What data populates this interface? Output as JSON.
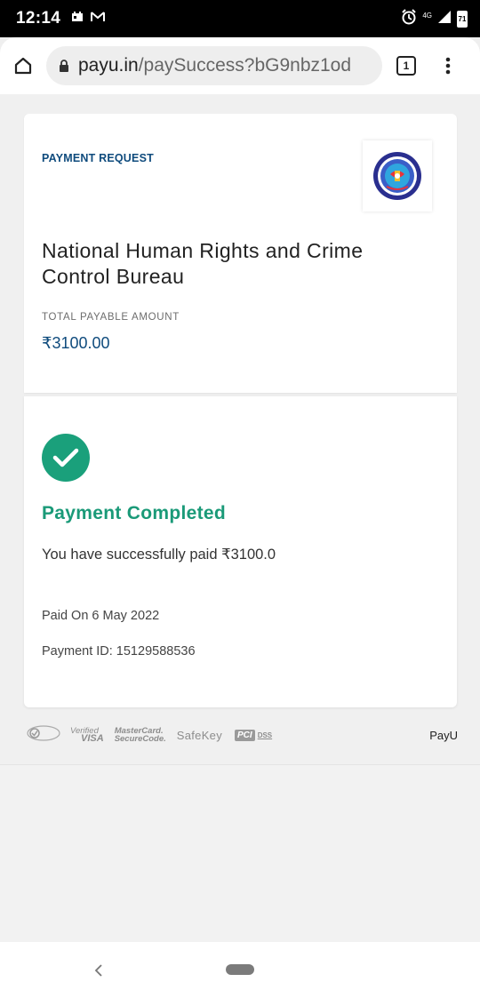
{
  "status_bar": {
    "time": "12:14",
    "network": "4G",
    "battery": "71"
  },
  "browser": {
    "url_domain": "payu.in",
    "url_path": "/paySuccess?bG9nbz1od",
    "tab_count": "1"
  },
  "payment_request": {
    "label": "PAYMENT REQUEST",
    "merchant_name": "National Human Rights and Crime Control Bureau",
    "total_label": "TOTAL PAYABLE AMOUNT",
    "total_amount": "₹3100.00"
  },
  "result": {
    "status_title": "Payment Completed",
    "message": "You have successfully paid ₹3100.0",
    "paid_on": "Paid On 6 May 2022",
    "payment_id": "Payment ID: 15129588536"
  },
  "secure_badges": {
    "visa_line1": "Verified",
    "visa_line2": "VISA",
    "mastercard_line1": "MasterCard.",
    "mastercard_line2": "SecureCode.",
    "safekey": "SafeKey",
    "pci": "PCI",
    "dss": "DSS",
    "brand": "PayU"
  },
  "colors": {
    "accent_blue": "#0f4b7d",
    "success_green": "#1aa07b"
  }
}
